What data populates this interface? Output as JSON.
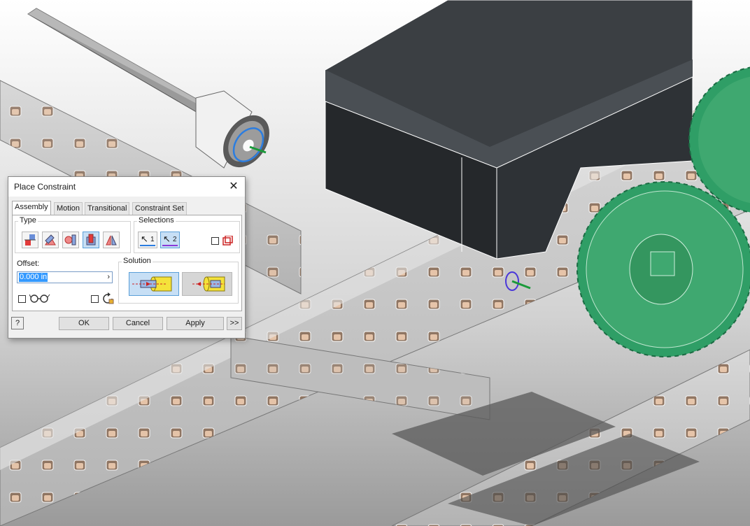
{
  "dialog": {
    "title": "Place Constraint",
    "tabs": [
      {
        "label": "Assembly",
        "active": true
      },
      {
        "label": "Motion",
        "active": false
      },
      {
        "label": "Transitional",
        "active": false
      },
      {
        "label": "Constraint Set",
        "active": false
      }
    ],
    "type_group": {
      "label": "Type",
      "buttons": [
        {
          "name": "mate",
          "selected": false
        },
        {
          "name": "angle",
          "selected": false
        },
        {
          "name": "tangent",
          "selected": false
        },
        {
          "name": "insert",
          "selected": true
        },
        {
          "name": "symmetry",
          "selected": false
        }
      ]
    },
    "selections_group": {
      "label": "Selections",
      "sel1": "1",
      "sel2": "2"
    },
    "offset": {
      "label": "Offset:",
      "value": "0.000 in"
    },
    "solution": {
      "label": "Solution"
    },
    "buttons": {
      "ok": "OK",
      "cancel": "Cancel",
      "apply": "Apply",
      "more": ">>",
      "help": "?"
    }
  },
  "colors": {
    "gear": "#3fa870",
    "motor": "#2e3236",
    "frame": "#c8c8c8",
    "selection": "#2b7de0"
  }
}
